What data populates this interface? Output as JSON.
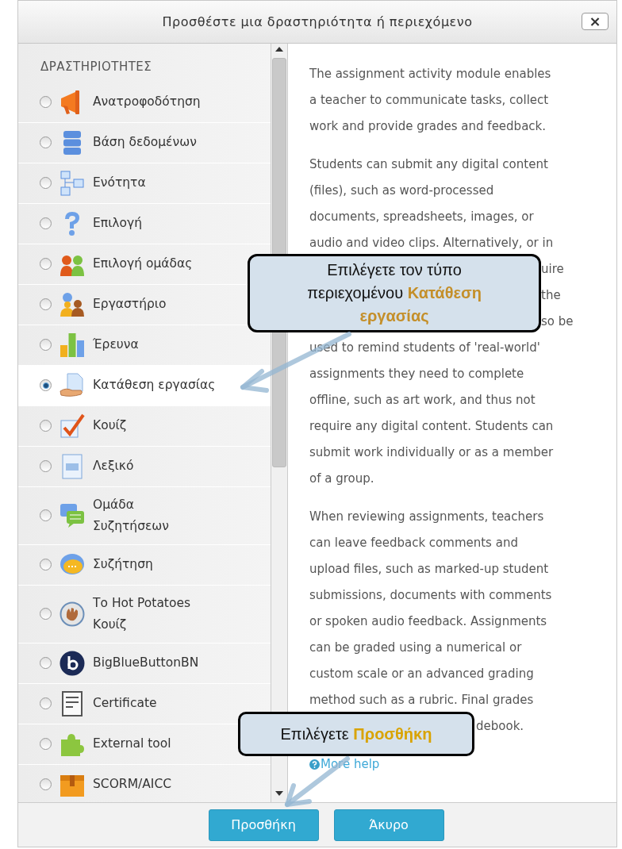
{
  "window": {
    "title": "Προσθέστε μια δραστηριότητα ή περιεχόμενο",
    "close": "×"
  },
  "activities": {
    "heading": "ΔΡΑΣΤΗΡΙΟΤΗΤΕΣ",
    "items": [
      {
        "lines": [
          "Ανατροφοδότηση"
        ],
        "kind": "megaphone",
        "selected": false
      },
      {
        "lines": [
          "Βάση δεδομένων"
        ],
        "kind": "database",
        "selected": false
      },
      {
        "lines": [
          "Ενότητα"
        ],
        "kind": "tree",
        "selected": false
      },
      {
        "lines": [
          "Επιλογή"
        ],
        "kind": "question",
        "selected": false
      },
      {
        "lines": [
          "Επιλογή ομάδας"
        ],
        "kind": "people",
        "selected": false
      },
      {
        "lines": [
          "Εργαστήριο"
        ],
        "kind": "workshop",
        "selected": false
      },
      {
        "lines": [
          "Έρευνα"
        ],
        "kind": "chart",
        "selected": false
      },
      {
        "lines": [
          "Κατάθεση εργασίας"
        ],
        "kind": "hand",
        "selected": true
      },
      {
        "lines": [
          "Κουίζ"
        ],
        "kind": "check",
        "selected": false
      },
      {
        "lines": [
          "Λεξικό"
        ],
        "kind": "book",
        "selected": false
      },
      {
        "lines": [
          "Ομάδα",
          "Συζητήσεων"
        ],
        "kind": "forum",
        "selected": false
      },
      {
        "lines": [
          "Συζήτηση"
        ],
        "kind": "bubble",
        "selected": false
      },
      {
        "lines": [
          "Το Hot Potatoes",
          "Κουίζ"
        ],
        "kind": "glove",
        "selected": false
      },
      {
        "lines": [
          "BigBlueButtonBN"
        ],
        "kind": "bbb",
        "selected": false
      },
      {
        "lines": [
          "Certificate"
        ],
        "kind": "certificate",
        "selected": false
      },
      {
        "lines": [
          "External tool"
        ],
        "kind": "puzzle",
        "selected": false
      },
      {
        "lines": [
          "SCORM/AICC"
        ],
        "kind": "box",
        "selected": false
      }
    ]
  },
  "description": {
    "blocks": [
      {
        "kind": "para",
        "lines": [
          "The assignment activity module enables",
          "a teacher to communicate tasks, collect",
          "work and provide grades and feedback."
        ]
      },
      {
        "kind": "lead",
        "lines": [
          "Students can submit any digital content",
          "(files), such as word-processed",
          "documents, spreadsheets, images, or",
          "audio and video clips. Alternatively, or in"
        ]
      },
      {
        "kind": "tail-wide",
        "lines": [
          "uire"
        ]
      },
      {
        "kind": "tail-wide",
        "lines": [
          "the"
        ]
      },
      {
        "kind": "tail-wide",
        "lines": [
          "so be"
        ]
      },
      {
        "kind": "para",
        "lines": [
          "used to remind students of 'real-world'",
          "assignments they need to complete",
          "offline, such as art work, and thus not",
          "require any digital content. Students can",
          "submit work individually or as a member",
          "of a group."
        ]
      },
      {
        "kind": "lead",
        "lines": [
          "When reviewing assignments, teachers",
          "can leave feedback comments and",
          "upload files, such as marked-up student",
          "submissions, documents with comments",
          "or spoken audio feedback. Assignments",
          "can be graded using a numerical or",
          "custom scale or an advanced grading",
          "method such as a rubric. Final grades"
        ]
      },
      {
        "kind": "tail-narrow",
        "lines": [
          "debook."
        ]
      }
    ],
    "more_help": "More help"
  },
  "buttons": [
    {
      "label": "Προσθήκη"
    },
    {
      "label": "Άκυρο"
    }
  ],
  "callouts": [
    {
      "lines": [
        "Επιλέγετε τον τύπο",
        "περιεχομένου **Κατάθεση**",
        "**εργασίας**"
      ]
    },
    {
      "lines": [
        "Επιλέγετε **Προσθήκη**"
      ]
    }
  ]
}
